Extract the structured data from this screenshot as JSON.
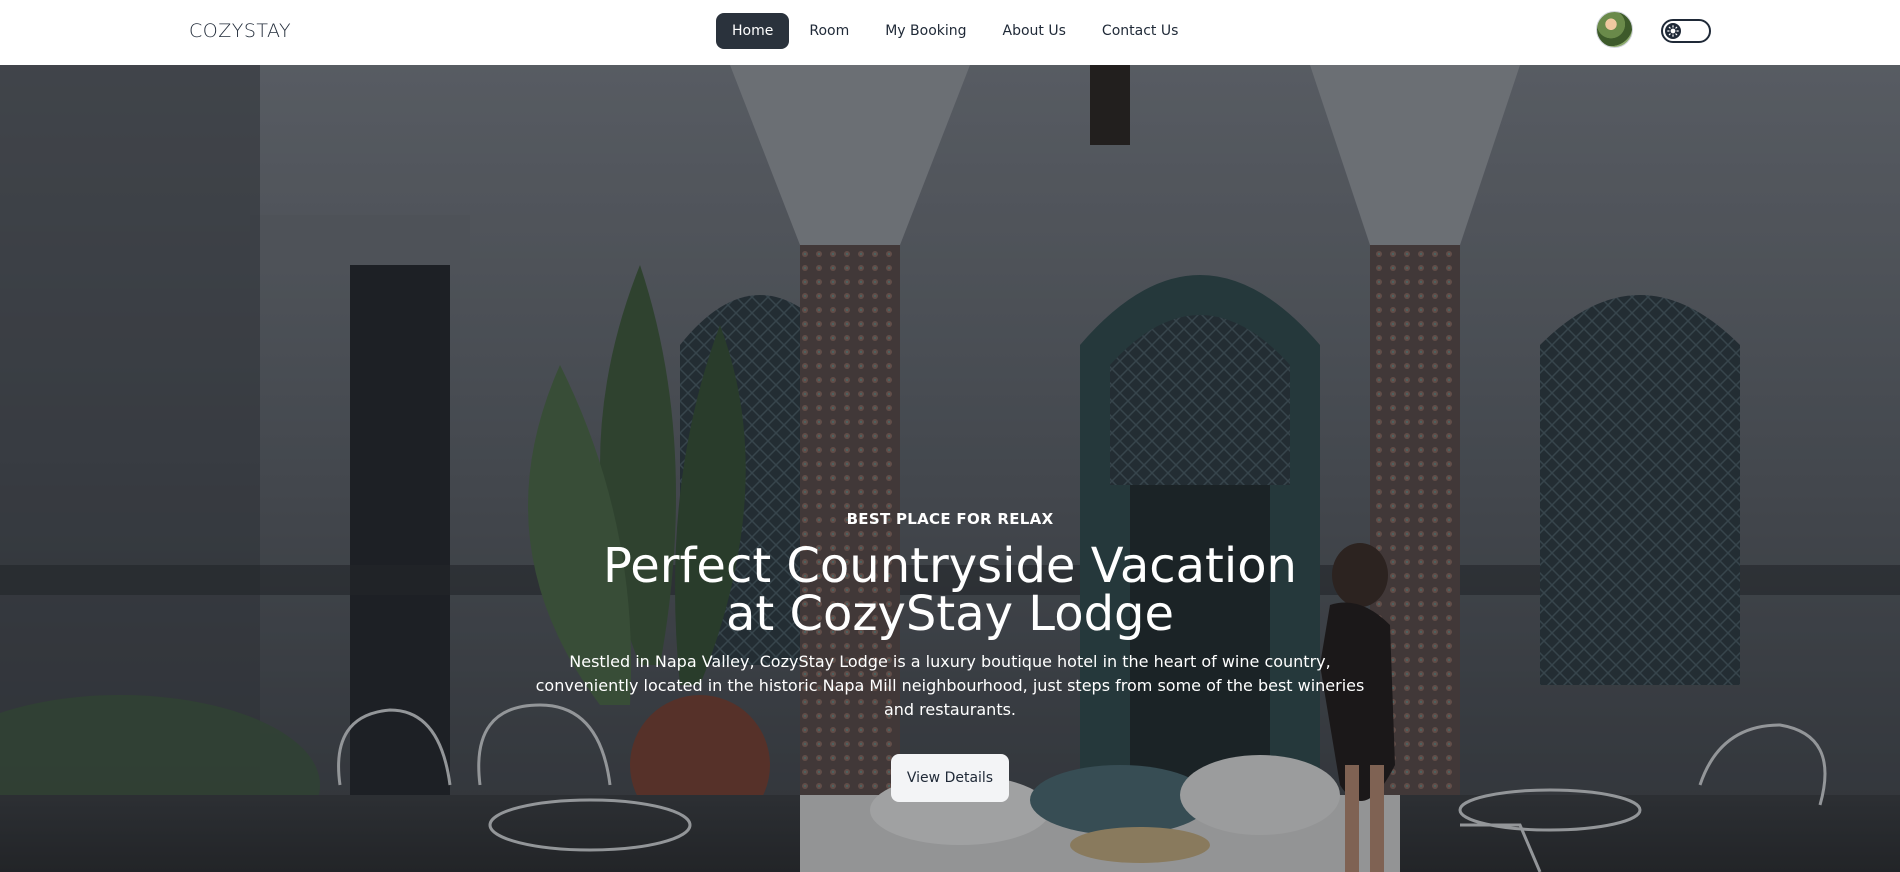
{
  "brand": "COZYSTAY",
  "nav": {
    "items": [
      "Home",
      "Room",
      "My Booking",
      "About Us",
      "Contact Us"
    ],
    "active": "Home"
  },
  "hero": {
    "eyebrow": "BEST PLACE FOR RELAX",
    "title": "Perfect Countryside Vacation at CozyStay Lodge",
    "description": "Nestled in Napa Valley, CozyStay Lodge is a luxury boutique hotel in the heart of wine country, conveniently located in the historic Napa Mill neighbourhood, just steps from some of the best wineries and restaurants.",
    "cta_label": "View Details"
  },
  "colors": {
    "nav_active_bg": "#2a323c",
    "cta_bg": "#f3f4f6",
    "text_dark": "#1f2937"
  },
  "icons": {
    "theme_toggle": "sun-icon",
    "avatar": "user-avatar"
  }
}
